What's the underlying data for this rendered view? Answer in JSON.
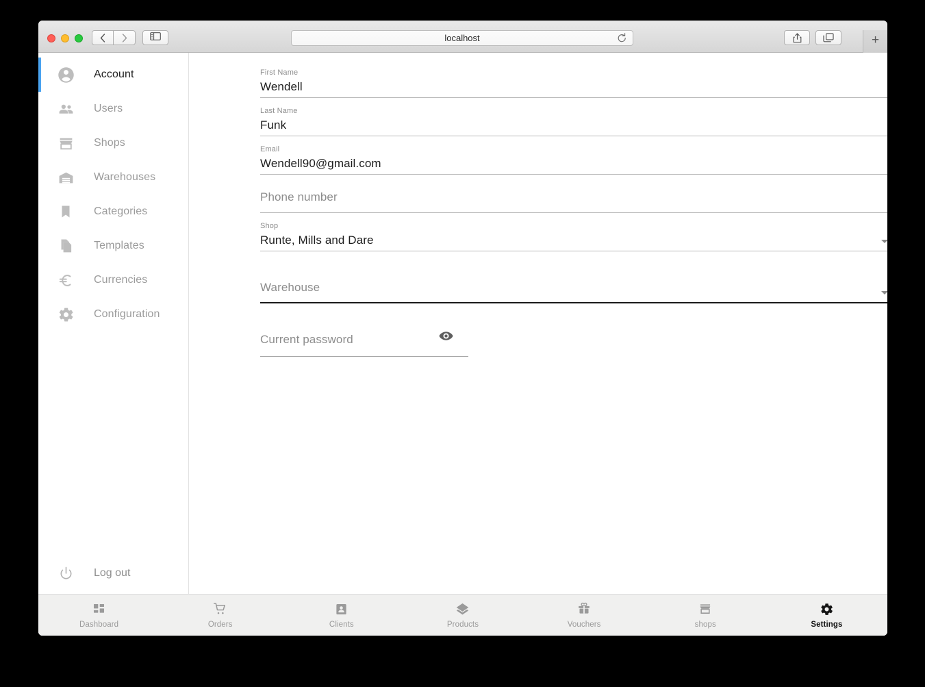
{
  "window": {
    "title": "localhost",
    "traffic_lights": [
      "close",
      "minimize",
      "maximize"
    ],
    "toolbar": {
      "back_label": "Back",
      "forward_label": "Forward",
      "sidebar_label": "Show Sidebar",
      "share_label": "Share",
      "tabs_label": "Show Tab Overview",
      "new_tab_label": "+",
      "reload_label": "Reload"
    }
  },
  "sidebar": {
    "items": [
      {
        "label": "Account",
        "icon": "account-circle-icon",
        "active": true
      },
      {
        "label": "Users",
        "icon": "people-icon",
        "active": false
      },
      {
        "label": "Shops",
        "icon": "store-icon",
        "active": false
      },
      {
        "label": "Warehouses",
        "icon": "warehouse-icon",
        "active": false
      },
      {
        "label": "Categories",
        "icon": "bookmark-icon",
        "active": false
      },
      {
        "label": "Templates",
        "icon": "file-copy-icon",
        "active": false
      },
      {
        "label": "Currencies",
        "icon": "euro-icon",
        "active": false
      },
      {
        "label": "Configuration",
        "icon": "gear-icon",
        "active": false
      }
    ],
    "logout": {
      "label": "Log out",
      "icon": "power-icon"
    }
  },
  "form": {
    "fields": [
      {
        "id": "first-name",
        "label": "First Name",
        "value": "Wendell",
        "placeholder": "",
        "type": "text",
        "focused": false
      },
      {
        "id": "last-name",
        "label": "Last Name",
        "value": "Funk",
        "placeholder": "",
        "type": "text",
        "focused": false
      },
      {
        "id": "email",
        "label": "Email",
        "value": "Wendell90@gmail.com",
        "placeholder": "",
        "type": "text",
        "focused": false
      },
      {
        "id": "phone-number",
        "label": "",
        "value": "",
        "placeholder": "Phone number",
        "type": "text",
        "focused": false
      },
      {
        "id": "shop",
        "label": "Shop",
        "value": "Runte, Mills and Dare",
        "placeholder": "",
        "type": "dropdown",
        "focused": false
      },
      {
        "id": "warehouse",
        "label": "",
        "value": "",
        "placeholder": "Warehouse",
        "type": "dropdown",
        "focused": true
      }
    ],
    "password": {
      "placeholder": "Current password",
      "value": "",
      "toggle_icon": "eye-icon"
    }
  },
  "bottom_nav": {
    "tabs": [
      {
        "label": "Dashboard",
        "icon": "dashboard-icon",
        "active": false
      },
      {
        "label": "Orders",
        "icon": "cart-icon",
        "active": false
      },
      {
        "label": "Clients",
        "icon": "contacts-icon",
        "active": false
      },
      {
        "label": "Products",
        "icon": "layers-icon",
        "active": false
      },
      {
        "label": "Vouchers",
        "icon": "gift-icon",
        "active": false
      },
      {
        "label": "shops",
        "icon": "store-icon",
        "active": false
      },
      {
        "label": "Settings",
        "icon": "gear-icon",
        "active": true
      }
    ]
  },
  "colors": {
    "accent_blue": "#4aa3f0",
    "focus_underline": "#1a1a1a",
    "muted_text": "#9b9b9b",
    "primary_text": "#1d1d1d",
    "nav_bg": "#f0f0ef",
    "page_bg": "#ffffff",
    "desktop_bg": "#000000"
  }
}
